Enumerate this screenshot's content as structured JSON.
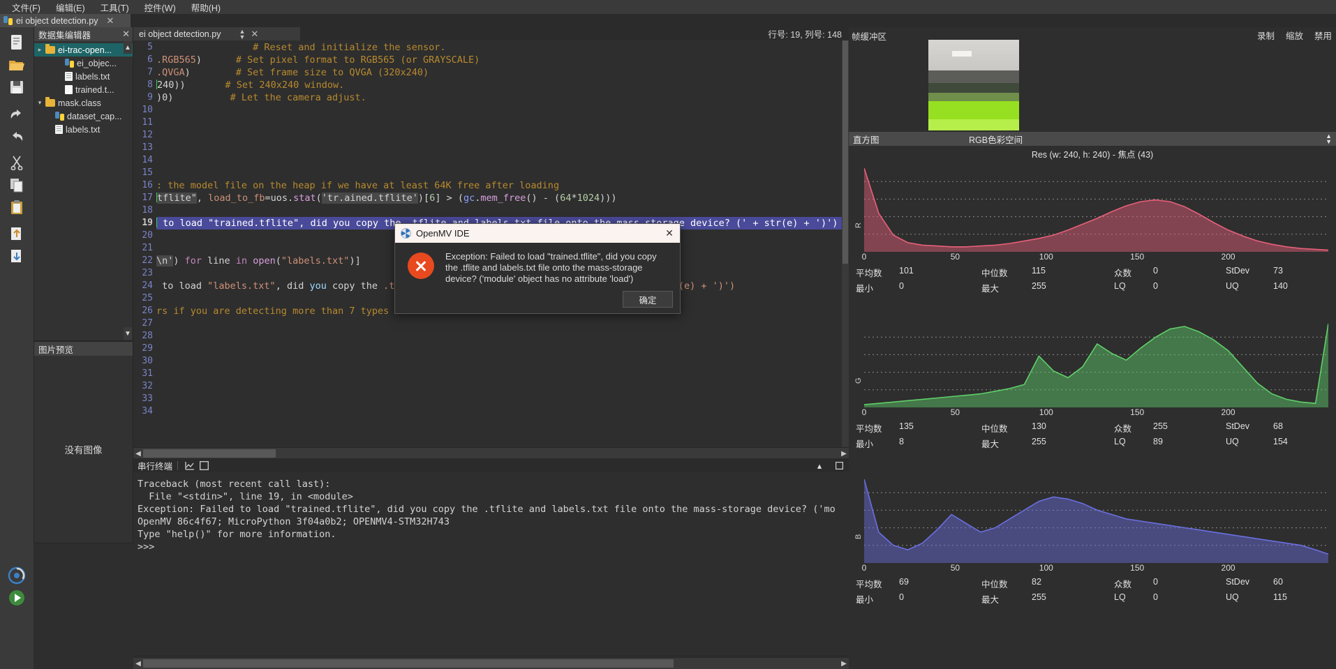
{
  "menubar": {
    "items": [
      {
        "label": "文件(F)",
        "name": "menu-file"
      },
      {
        "label": "编辑(E)",
        "name": "menu-edit"
      },
      {
        "label": "工具(T)",
        "name": "menu-tools"
      },
      {
        "label": "控件(W)",
        "name": "menu-widgets"
      },
      {
        "label": "帮助(H)",
        "name": "menu-help"
      }
    ]
  },
  "outer_tab": {
    "label": "ei object detection.py",
    "close": "✕"
  },
  "dataset_panel": {
    "title": "数据集编辑器",
    "close": "✕",
    "tree": [
      {
        "label": "ei-trac-open...",
        "icon": "folder-icon",
        "indent": 0,
        "twisty": "›",
        "selected": true
      },
      {
        "label": "ei_objec...",
        "icon": "python-file-icon",
        "indent": 2,
        "twisty": "",
        "selected": false
      },
      {
        "label": "labels.txt",
        "icon": "text-file-icon",
        "indent": 2,
        "twisty": "",
        "selected": false
      },
      {
        "label": "trained.t...",
        "icon": "blank-file-icon",
        "indent": 2,
        "twisty": "",
        "selected": false
      },
      {
        "label": "mask.class",
        "icon": "folder-icon",
        "indent": 0,
        "twisty": "⌄",
        "selected": false
      },
      {
        "label": "dataset_cap...",
        "icon": "python-file-icon",
        "indent": 1,
        "twisty": "",
        "selected": false
      },
      {
        "label": "labels.txt",
        "icon": "text-file-icon",
        "indent": 1,
        "twisty": "",
        "selected": false
      }
    ]
  },
  "preview_panel": {
    "title": "图片预览",
    "empty_text": "没有图像"
  },
  "editor": {
    "tab_label": "ei object detection.py",
    "tab_close": "✕",
    "status": "行号: 19, 列号: 148",
    "first_line": 5,
    "lines": [
      {
        "n": 5,
        "html": "                 <span class=\"c-com\"># Reset and initialize the sensor.</span>"
      },
      {
        "n": 6,
        "html": "<span class=\"c-str\">.RGB565</span>)      <span class=\"c-com\"># Set pixel format to RGB565 (or GRAYSCALE)</span>"
      },
      {
        "n": 7,
        "html": "<span class=\"c-str\">.QVGA</span>)        <span class=\"c-com\"># Set frame size to QVGA (320x240)</span>"
      },
      {
        "n": 8,
        "html": "<span class=\"caretbar\"></span>240))       <span class=\"c-com\"># Set 240x240 window.</span>"
      },
      {
        "n": 9,
        "html": ")0)          <span class=\"c-com\"># Let the camera adjust.</span>"
      },
      {
        "n": 10,
        "html": ""
      },
      {
        "n": 11,
        "html": ""
      },
      {
        "n": 12,
        "html": ""
      },
      {
        "n": 13,
        "html": ""
      },
      {
        "n": 14,
        "html": ""
      },
      {
        "n": 15,
        "html": ""
      },
      {
        "n": 16,
        "html": "<span class=\"c-com\">: the model file on the heap if we have at least 64K free after loading</span>"
      },
      {
        "n": 17,
        "html": "<span class=\"caretbar\"></span><span class=\"c-sel\">tflite\"</span>, <span class=\"c-str\">load_to_fb</span>=uos.<span class=\"c-fn\">stat</span>(<span class=\"c-sel\">'tr.ained.tflite'</span>)[<span class=\"c-num\">6</span>] &gt; (<span class=\"c-mod\">gc</span>.<span class=\"c-fn\">mem_free</span>() - (<span class=\"c-num\">64</span>*<span class=\"c-num\">1024</span>)))"
      },
      {
        "n": 18,
        "html": ""
      },
      {
        "n": 19,
        "html": "HL:| to load \"trained.tflite\", did you copy the .tflite and labels.txt file onto the mass-storage device? (' + str(e) + ')')"
      },
      {
        "n": 20,
        "html": ""
      },
      {
        "n": 21,
        "html": ""
      },
      {
        "n": 22,
        "html": "<span class=\"c-sel\">\\n'</span>) <span class=\"c-kw\">for</span> line <span class=\"c-kw\">in</span> <span class=\"c-fn\">open</span>(<span class=\"c-str\">\"labels.txt\"</span>)]"
      },
      {
        "n": 23,
        "html": ""
      },
      {
        "n": 24,
        "html": " to load <span class=\"c-str\">\"labels.txt\"</span>, did <span class=\"c-var\">you</span> copy the <span class=\"c-str\">.t</span>                                    <span class=\"c-str\">vice? (' + str(e) + ')')</span>"
      },
      {
        "n": 25,
        "html": ""
      },
      {
        "n": 26,
        "html": "<span class=\"c-com\">rs if you are detecting more than 7 types of classes be thus.</span>"
      },
      {
        "n": 27,
        "html": ""
      },
      {
        "n": 28,
        "html": ""
      },
      {
        "n": 29,
        "html": ""
      },
      {
        "n": 30,
        "html": ""
      },
      {
        "n": 31,
        "html": ""
      },
      {
        "n": 32,
        "html": ""
      },
      {
        "n": 33,
        "html": ""
      },
      {
        "n": 34,
        "html": ""
      }
    ]
  },
  "terminal": {
    "title": "串行终端",
    "lines": [
      "Traceback (most recent call last):",
      "  File \"<stdin>\", line 19, in <module>",
      "Exception: Failed to load \"trained.tflite\", did you copy the .tflite and labels.txt file onto the mass-storage device? ('mo",
      "OpenMV 86c4f67; MicroPython 3f04a0b2; OPENMV4-STM32H743",
      "Type \"help()\" for more information.",
      ">>>"
    ]
  },
  "framebuffer": {
    "label": "帧缓冲区",
    "controls": [
      {
        "label": "录制",
        "name": "record-button"
      },
      {
        "label": "缩放",
        "name": "zoom-button"
      },
      {
        "label": "禁用",
        "name": "disable-button"
      }
    ]
  },
  "histogram": {
    "title": "直方图",
    "colorspace": "RGB色彩空间",
    "res_line": "Res  (w: 240, h: 240) - 焦点 (43)",
    "xticks": [
      "0",
      "50",
      "100",
      "150",
      "200"
    ],
    "stat_keys": {
      "mean": "平均数",
      "median": "中位数",
      "mode": "众数",
      "stdev": "StDev",
      "min": "最小",
      "max": "最大",
      "lq": "LQ",
      "uq": "UQ"
    },
    "channels": [
      {
        "name": "R",
        "color": "#e8607a",
        "stats": {
          "mean": "101",
          "median": "115",
          "mode": "0",
          "stdev": "73",
          "min": "0",
          "max": "255",
          "lq": "0",
          "uq": "140"
        }
      },
      {
        "name": "G",
        "color": "#5fd06a",
        "stats": {
          "mean": "135",
          "median": "130",
          "mode": "255",
          "stdev": "68",
          "min": "8",
          "max": "255",
          "lq": "89",
          "uq": "154"
        }
      },
      {
        "name": "B",
        "color": "#6a6fe0",
        "stats": {
          "mean": "69",
          "median": "82",
          "mode": "0",
          "stdev": "60",
          "min": "0",
          "max": "255",
          "lq": "0",
          "uq": "115"
        }
      }
    ]
  },
  "dialog": {
    "title": "OpenMV IDE",
    "close": "✕",
    "message": "Exception: Failed to load \"trained.tflite\", did you copy the .tflite and labels.txt file onto the mass-storage device? ('module' object has no attribute 'load')",
    "ok_label": "确定"
  },
  "chart_data": [
    {
      "type": "area",
      "title": "R",
      "xlabel": "",
      "ylabel": "R",
      "xlim": [
        0,
        255
      ],
      "grid": true,
      "x": [
        0,
        8,
        16,
        24,
        32,
        40,
        48,
        56,
        64,
        72,
        80,
        88,
        96,
        104,
        112,
        120,
        128,
        136,
        144,
        152,
        160,
        168,
        176,
        184,
        192,
        200,
        208,
        216,
        224,
        232,
        240,
        248,
        255
      ],
      "values": [
        100,
        46,
        20,
        11,
        8,
        7,
        6,
        6,
        7,
        8,
        10,
        13,
        16,
        20,
        26,
        33,
        40,
        48,
        55,
        60,
        62,
        60,
        54,
        45,
        35,
        26,
        19,
        13,
        9,
        6,
        4,
        3,
        2
      ]
    },
    {
      "type": "area",
      "title": "G",
      "xlabel": "",
      "ylabel": "G",
      "xlim": [
        0,
        255
      ],
      "grid": true,
      "x": [
        0,
        8,
        16,
        24,
        32,
        40,
        48,
        56,
        64,
        72,
        80,
        88,
        96,
        104,
        112,
        120,
        128,
        136,
        144,
        152,
        160,
        168,
        176,
        184,
        192,
        200,
        208,
        216,
        224,
        232,
        240,
        248,
        255
      ],
      "values": [
        2,
        3,
        4,
        5,
        6,
        7,
        8,
        9,
        10,
        12,
        14,
        17,
        38,
        27,
        22,
        30,
        47,
        40,
        35,
        44,
        52,
        58,
        60,
        56,
        50,
        42,
        30,
        18,
        10,
        6,
        4,
        3,
        62
      ]
    },
    {
      "type": "area",
      "title": "B",
      "xlabel": "",
      "ylabel": "B",
      "xlim": [
        0,
        255
      ],
      "grid": true,
      "x": [
        0,
        8,
        16,
        24,
        32,
        40,
        48,
        56,
        64,
        72,
        80,
        88,
        96,
        104,
        112,
        120,
        128,
        136,
        144,
        152,
        160,
        168,
        176,
        184,
        192,
        200,
        208,
        216,
        224,
        232,
        240,
        248,
        255
      ],
      "values": [
        38,
        14,
        8,
        6,
        9,
        15,
        22,
        18,
        14,
        16,
        20,
        24,
        28,
        30,
        29,
        27,
        24,
        22,
        20,
        19,
        18,
        17,
        16,
        15,
        14,
        13,
        12,
        11,
        10,
        9,
        8,
        6,
        4
      ]
    }
  ]
}
